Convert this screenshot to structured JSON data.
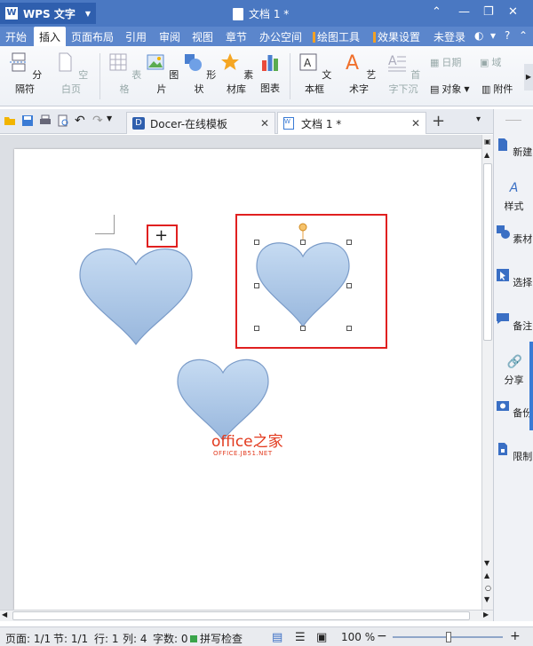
{
  "app": {
    "name": "WPS 文字",
    "doc_title": "文档 1 *"
  },
  "menu": {
    "items": [
      "开始",
      "插入",
      "页面布局",
      "引用",
      "审阅",
      "视图",
      "章节",
      "办公空间"
    ],
    "tools": [
      "绘图工具",
      "效果设置"
    ],
    "login": "未登录"
  },
  "ribbon": {
    "page_break": "分隔符",
    "blank_page": "空白页",
    "table": "表格",
    "picture": "图片",
    "shape": "形状",
    "material": "素材库",
    "chart": "图表",
    "textbox": "文本框",
    "wordart": "艺术字",
    "dropcap": "首字下沉",
    "date": "日期",
    "field": "域",
    "object": "对象",
    "attachment": "附件"
  },
  "tabs": [
    {
      "label": "Docer-在线模板"
    },
    {
      "label": "文档 1 *"
    }
  ],
  "side_panel": [
    "新建",
    "样式",
    "素材",
    "选择",
    "备注",
    "分享",
    "备份",
    "限制"
  ],
  "status": {
    "page": "页面: 1/1",
    "section": "节: 1/1",
    "line": "行: 1",
    "col": "列: 4",
    "words": "字数: 0",
    "spell": "拼写检查",
    "zoom": "100 %"
  },
  "watermark": {
    "main": "office之家",
    "sub": "OFFICE.JB51.NET"
  },
  "colors": {
    "title": "#4a78c2",
    "heart_top": "#c6dbf2",
    "heart_bottom": "#98b7dd",
    "accent_red": "#e02020"
  }
}
